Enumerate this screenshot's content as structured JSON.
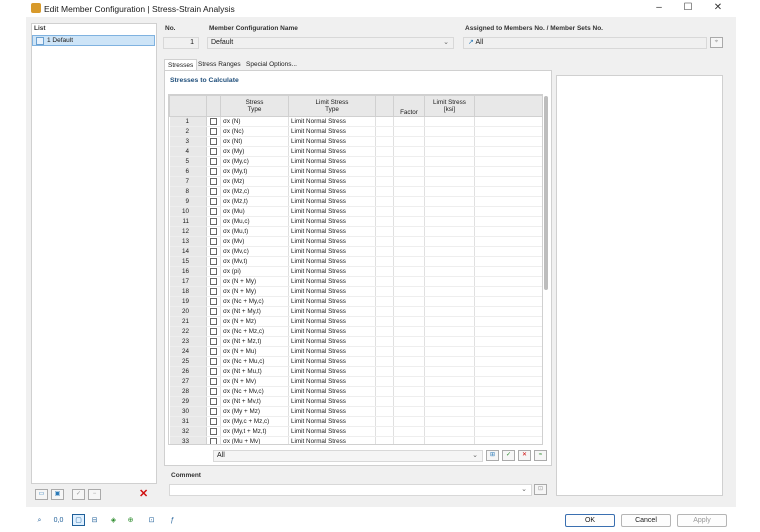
{
  "window": {
    "title": "Edit Member Configuration | Stress-Strain Analysis",
    "minimize": "–",
    "maximize": "☐",
    "close": "✕"
  },
  "list": {
    "header": "List",
    "item": "1  Default"
  },
  "no": {
    "label": "No.",
    "value": "1"
  },
  "config_name": {
    "label": "Member Configuration Name",
    "value": "Default"
  },
  "assigned": {
    "label": "Assigned to Members No. / Member Sets No.",
    "value": "All"
  },
  "tabs": [
    "Stresses",
    "Stress Ranges",
    "Special Options..."
  ],
  "section_title": "Stresses to Calculate",
  "columns": {
    "stress": "Stress",
    "stress2": "Type",
    "limit": "Limit Stress",
    "limit2": "Type",
    "factor": "Factor",
    "limit_ksi": "Limit Stress",
    "limit_ksi2": "[ksi]"
  },
  "rows": [
    [
      "1",
      "σx (N)"
    ],
    [
      "2",
      "σx (Nc)"
    ],
    [
      "3",
      "σx (Nt)"
    ],
    [
      "4",
      "σx (My)"
    ],
    [
      "5",
      "σx (My,c)"
    ],
    [
      "6",
      "σx (My,t)"
    ],
    [
      "7",
      "σx (Mz)"
    ],
    [
      "8",
      "σx (Mz,c)"
    ],
    [
      "9",
      "σx (Mz,t)"
    ],
    [
      "10",
      "σx (Mu)"
    ],
    [
      "11",
      "σx (Mu,c)"
    ],
    [
      "12",
      "σx (Mu,t)"
    ],
    [
      "13",
      "σx (Mv)"
    ],
    [
      "14",
      "σx (Mv,c)"
    ],
    [
      "15",
      "σx (Mv,t)"
    ],
    [
      "16",
      "σx (pi)"
    ],
    [
      "17",
      "σx (N + My)"
    ],
    [
      "18",
      "σx (N + My)"
    ],
    [
      "19",
      "σx (Nc + My,c)"
    ],
    [
      "20",
      "σx (Nt + My,t)"
    ],
    [
      "21",
      "σx (N + Mz)"
    ],
    [
      "22",
      "σx (Nc + Mz,c)"
    ],
    [
      "23",
      "σx (Nt + Mz,t)"
    ],
    [
      "24",
      "σx (N + Mu)"
    ],
    [
      "25",
      "σx (Nc + Mu,c)"
    ],
    [
      "26",
      "σx (Nt + Mu,t)"
    ],
    [
      "27",
      "σx (N + Mv)"
    ],
    [
      "28",
      "σx (Nc + Mv,c)"
    ],
    [
      "29",
      "σx (Nt + Mv,t)"
    ],
    [
      "30",
      "σx (My + Mz)"
    ],
    [
      "31",
      "σx (My,c + Mz,c)"
    ],
    [
      "32",
      "σx (My,t + Mz,t)"
    ],
    [
      "33",
      "σx (Mu + Mv)"
    ],
    [
      "34",
      "σx (Mu,c + Mv,c)"
    ]
  ],
  "limit_type": "Limit Normal Stress",
  "filter": {
    "value": "All"
  },
  "comment": {
    "label": "Comment",
    "value": ""
  },
  "buttons": {
    "ok": "OK",
    "cancel": "Cancel",
    "apply": "Apply"
  }
}
